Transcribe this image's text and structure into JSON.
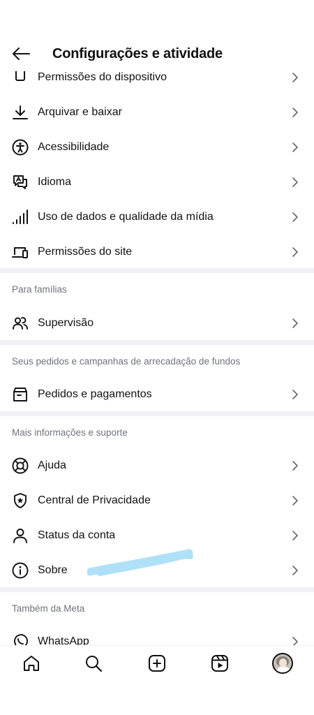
{
  "header": {
    "title": "Configurações e atividade"
  },
  "groups": [
    {
      "items": [
        {
          "label": "Permissões do dispositivo",
          "icon": "device-permissions-icon"
        },
        {
          "label": "Arquivar e baixar",
          "icon": "download-icon"
        },
        {
          "label": "Acessibilidade",
          "icon": "accessibility-icon"
        },
        {
          "label": "Idioma",
          "icon": "language-icon"
        },
        {
          "label": "Uso de dados e qualidade da mídia",
          "icon": "signal-bars-icon"
        },
        {
          "label": "Permissões do site",
          "icon": "laptop-phone-icon"
        }
      ]
    },
    {
      "title": "Para famílias",
      "items": [
        {
          "label": "Supervisão",
          "icon": "people-icon"
        }
      ]
    },
    {
      "title": "Seus pedidos e campanhas de arrecadação de fundos",
      "items": [
        {
          "label": "Pedidos e pagamentos",
          "icon": "box-icon"
        }
      ]
    },
    {
      "title": "Mais informações e suporte",
      "items": [
        {
          "label": "Ajuda",
          "icon": "lifebuoy-icon"
        },
        {
          "label": "Central de Privacidade",
          "icon": "shield-star-icon"
        },
        {
          "label": "Status da conta",
          "icon": "person-icon"
        },
        {
          "label": "Sobre",
          "icon": "info-icon"
        }
      ]
    },
    {
      "title": "Também da Meta",
      "items": [
        {
          "label": "WhatsApp",
          "icon": "whatsapp-icon"
        }
      ]
    }
  ],
  "bottom_nav": [
    {
      "icon": "home-icon"
    },
    {
      "icon": "search-icon"
    },
    {
      "icon": "create-icon"
    },
    {
      "icon": "reels-icon"
    },
    {
      "icon": "profile-avatar"
    }
  ],
  "colors": {
    "divider": "#eff1f3",
    "section_title": "#6f7378",
    "text": "#111111",
    "scribble": "#aee1f7"
  }
}
